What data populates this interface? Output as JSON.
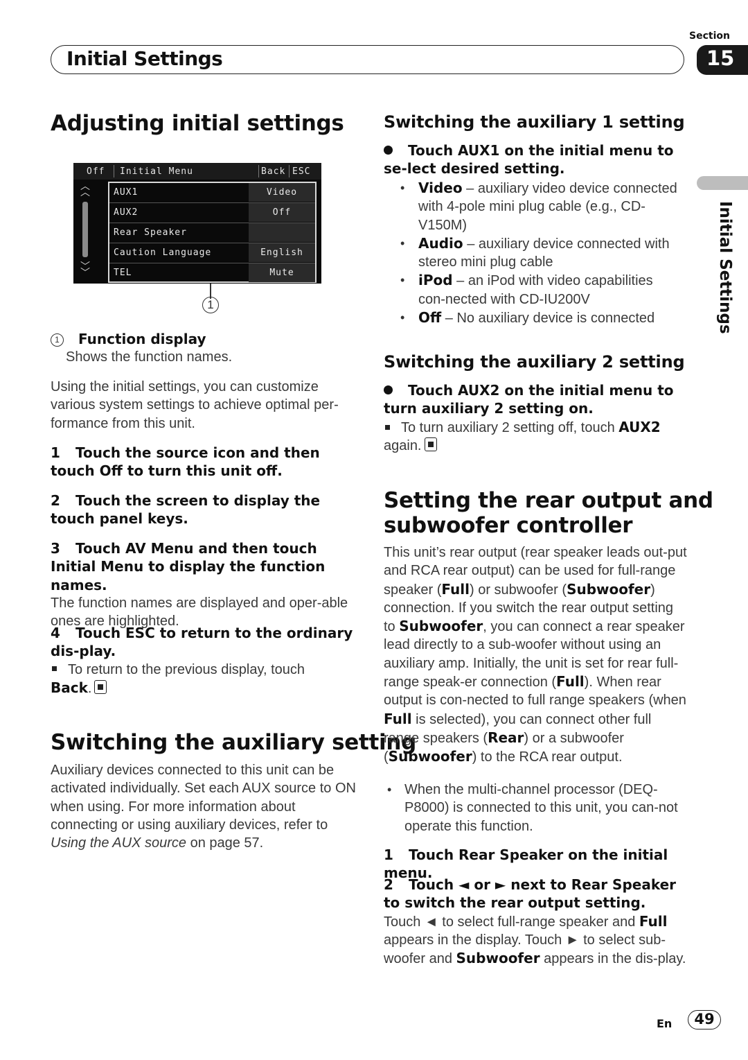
{
  "header": {
    "section_label": "Section",
    "section_number": "15",
    "title": "Initial Settings"
  },
  "side_tab": {
    "label": "Initial Settings"
  },
  "left": {
    "heading": "Adjusting initial settings",
    "screen": {
      "top_bar": {
        "off": "Off",
        "title": "Initial Menu",
        "back": "Back",
        "esc": "ESC"
      },
      "rows": [
        {
          "name": "AUX1",
          "value": "Video"
        },
        {
          "name": "AUX2",
          "value": "Off"
        },
        {
          "name": "Rear Speaker",
          "value": ""
        },
        {
          "name": "Caution Language",
          "value": "English"
        },
        {
          "name": "TEL",
          "value": "Mute"
        }
      ],
      "callout": "1"
    },
    "legend": {
      "num": "1",
      "title": "Function display",
      "desc": "Shows the function names."
    },
    "intro": "Using the initial settings, you can customize various system settings to achieve optimal per-formance from this unit.",
    "steps": [
      {
        "num": "1",
        "text": "Touch the source icon and then touch Off to turn this unit off."
      },
      {
        "num": "2",
        "text": "Touch the screen to display the touch panel keys."
      },
      {
        "num": "3",
        "text": "Touch AV Menu and then touch Initial Menu to display the function names.",
        "desc": "The function names are displayed and oper-able ones are highlighted."
      },
      {
        "num": "4",
        "text": "Touch ESC to return to the ordinary dis-play.",
        "note_pre": "To return to the previous display, touch",
        "note_bold": "Back",
        "note_post": "."
      }
    ],
    "aux_heading": "Switching the auxiliary setting",
    "aux_body": "Auxiliary devices connected to this unit can be activated individually. Set each AUX source to ON when using. For more information about connecting or using auxiliary devices, refer to",
    "aux_link": "Using the AUX source",
    "aux_tail": "on page 57."
  },
  "right": {
    "aux1": {
      "heading": "Switching the auxiliary 1 setting",
      "instruction": "Touch AUX1 on the initial menu to se-lect desired setting.",
      "options": [
        {
          "name": "Video",
          "desc": "– auxiliary video device connected with 4-pole mini plug cable (e.g., CD-V150M)"
        },
        {
          "name": "Audio",
          "desc": "– auxiliary device connected with stereo mini plug cable"
        },
        {
          "name": "iPod",
          "desc": "– an iPod with video capabilities con-nected with CD-IU200V"
        },
        {
          "name": "Off",
          "desc": "– No auxiliary device is connected"
        }
      ]
    },
    "aux2": {
      "heading": "Switching the auxiliary 2 setting",
      "instruction": "Touch AUX2 on the initial menu to turn auxiliary 2 setting on.",
      "note_pre": "To turn auxiliary 2 setting off, touch",
      "note_bold": "AUX2",
      "note_post": "again."
    },
    "rear": {
      "heading_line1": "Setting the rear output and",
      "heading_line2": "subwoofer controller",
      "body": [
        {
          "t": "This unit’s rear output (rear speaker leads out-put and RCA rear output) can be used for full-range speaker ("
        },
        {
          "b": "Full"
        },
        {
          "t": ") or subwoofer ("
        },
        {
          "b": "Subwoofer"
        },
        {
          "t": ") connection. If you switch the rear output setting to "
        },
        {
          "b": "Subwoofer"
        },
        {
          "t": ", you can connect a rear speaker lead directly to a sub-woofer without using an auxiliary amp. Initially, the unit is set for rear full-range speak-er connection ("
        },
        {
          "b": "Full"
        },
        {
          "t": "). When rear output is con-nected to full range speakers (when "
        },
        {
          "b": "Full"
        },
        {
          "t": " is selected), you can connect other full range speakers ("
        },
        {
          "b": "Rear"
        },
        {
          "t": ") or a subwoofer ("
        },
        {
          "b": "Subwoofer"
        },
        {
          "t": ") to the RCA rear output."
        }
      ],
      "bullet": "When the multi-channel processor (DEQ-P8000) is connected to this unit, you can-not operate this function.",
      "steps": [
        {
          "num": "1",
          "text": "Touch Rear Speaker on the initial menu."
        },
        {
          "num": "2",
          "text": "Touch ◄ or ► next to Rear Speaker to switch the rear output setting."
        }
      ],
      "step2_desc": [
        {
          "t": "Touch ◄ to select full-range speaker and "
        },
        {
          "b": "Full"
        },
        {
          "t": " appears in the display. Touch ► to select sub-woofer and "
        },
        {
          "b": "Subwoofer"
        },
        {
          "t": " appears in the dis-play."
        }
      ]
    }
  },
  "footer": {
    "lang": "En",
    "page": "49"
  }
}
